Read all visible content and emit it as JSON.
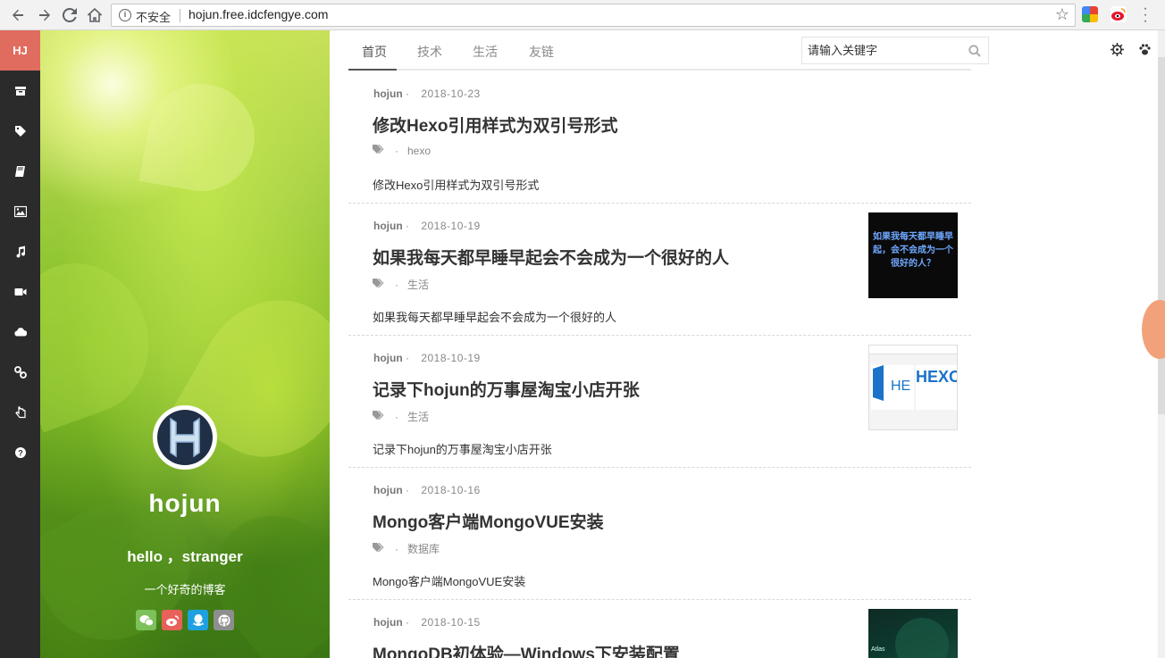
{
  "browser": {
    "insecure_label": "不安全",
    "url": "hojun.free.idcfengye.com"
  },
  "sidebar": {
    "logo": "HJ",
    "icons": [
      "archive-icon",
      "tags-icon",
      "book-icon",
      "image-icon",
      "music-icon",
      "video-icon",
      "cloud-icon",
      "link-icon",
      "hand-icon",
      "help-icon"
    ]
  },
  "profile": {
    "name": "hojun",
    "greeting": "hello ，stranger",
    "motto": "一个好奇的博客",
    "socials": [
      {
        "name": "wechat",
        "color": "#7cc159"
      },
      {
        "name": "weibo",
        "color": "#e8605a"
      },
      {
        "name": "qq",
        "color": "#1da1e0"
      },
      {
        "name": "github",
        "color": "#8e8e8e"
      }
    ]
  },
  "nav": {
    "tabs": [
      "首页",
      "技术",
      "生活",
      "友链"
    ],
    "search_placeholder": "请输入关键字"
  },
  "posts": [
    {
      "author": "hojun",
      "date": "2018-10-23",
      "title": "修改Hexo引用样式为双引号形式",
      "tag": "hexo",
      "excerpt": "修改Hexo引用样式为双引号形式",
      "thumb": ""
    },
    {
      "author": "hojun",
      "date": "2018-10-19",
      "title": "如果我每天都早睡早起会不会成为一个很好的人",
      "tag": "生活",
      "excerpt": "如果我每天都早睡早起会不会成为一个很好的人",
      "thumb": "dark-text",
      "thumb_text": "如果我每天都早睡早起，会不会成为一个很好的人？"
    },
    {
      "author": "hojun",
      "date": "2018-10-19",
      "title": "记录下hojun的万事屋淘宝小店开张",
      "tag": "生活",
      "excerpt": "记录下hojun的万事屋淘宝小店开张",
      "thumb": "shop",
      "thumb_text": "HEXO"
    },
    {
      "author": "hojun",
      "date": "2018-10-16",
      "title": "Mongo客户端MongoVUE安装",
      "tag": "数据库",
      "excerpt": "Mongo客户端MongoVUE安装",
      "thumb": ""
    },
    {
      "author": "hojun",
      "date": "2018-10-15",
      "title": "MongoDB初体验—Windows下安装配置",
      "tag": "",
      "excerpt": "",
      "thumb": "dark-green",
      "thumb_text": "Atlas"
    }
  ],
  "colors": {
    "accent": "#e06c5f",
    "sidebar_bg": "#2b2b2b"
  }
}
